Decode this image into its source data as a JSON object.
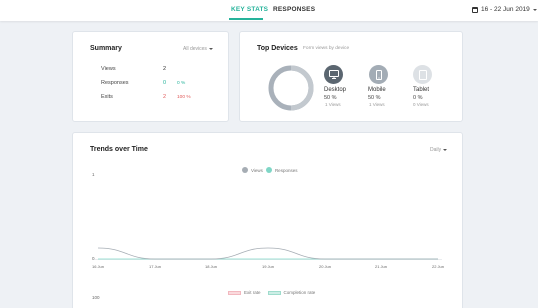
{
  "nav": {
    "tabs": [
      {
        "label": "KEY STATS",
        "active": true
      },
      {
        "label": "RESPONSES",
        "active": false
      }
    ],
    "date_range": "16 - 22 Jun 2019"
  },
  "summary": {
    "title": "Summary",
    "filter": "All devices",
    "rows": [
      {
        "label": "Views",
        "value": "2",
        "pct": ""
      },
      {
        "label": "Responses",
        "value": "0",
        "pct": "0 %"
      },
      {
        "label": "Exits",
        "value": "2",
        "pct": "100 %"
      }
    ],
    "colors": {
      "responses": "#26b39b",
      "exits": "#e05a5a"
    }
  },
  "devices": {
    "title": "Top Devices",
    "subtitle": "Form views by device",
    "items": [
      {
        "name": "Desktop",
        "pct": "50 %",
        "views": "1 Views",
        "icon": "desktop-icon",
        "active": true
      },
      {
        "name": "Mobile",
        "pct": "50 %",
        "views": "1 Views",
        "icon": "mobile-icon",
        "active": true
      },
      {
        "name": "Tablet",
        "pct": "0 %",
        "views": "0 Views",
        "icon": "tablet-icon",
        "active": false
      }
    ]
  },
  "trends": {
    "title": "Trends over Time",
    "interval": "Daily",
    "lower_y_top": "100",
    "lower_legend": [
      "Exit rate",
      "Completion rate"
    ]
  },
  "chart_data": {
    "type": "line",
    "categories": [
      "16 Jun",
      "17 Jun",
      "18 Jun",
      "19 Jun",
      "20 Jun",
      "21 Jun",
      "22 Jun"
    ],
    "series": [
      {
        "name": "Views",
        "values": [
          1,
          0,
          0,
          1,
          0,
          0,
          0
        ],
        "color": "#a6adb4"
      },
      {
        "name": "Responses",
        "values": [
          0,
          0,
          0,
          0,
          0,
          0,
          0
        ],
        "color": "#7fd6c6"
      }
    ],
    "y_ticks": [
      "1",
      "0"
    ],
    "ylim": [
      0,
      1
    ],
    "legend_position": "top"
  }
}
